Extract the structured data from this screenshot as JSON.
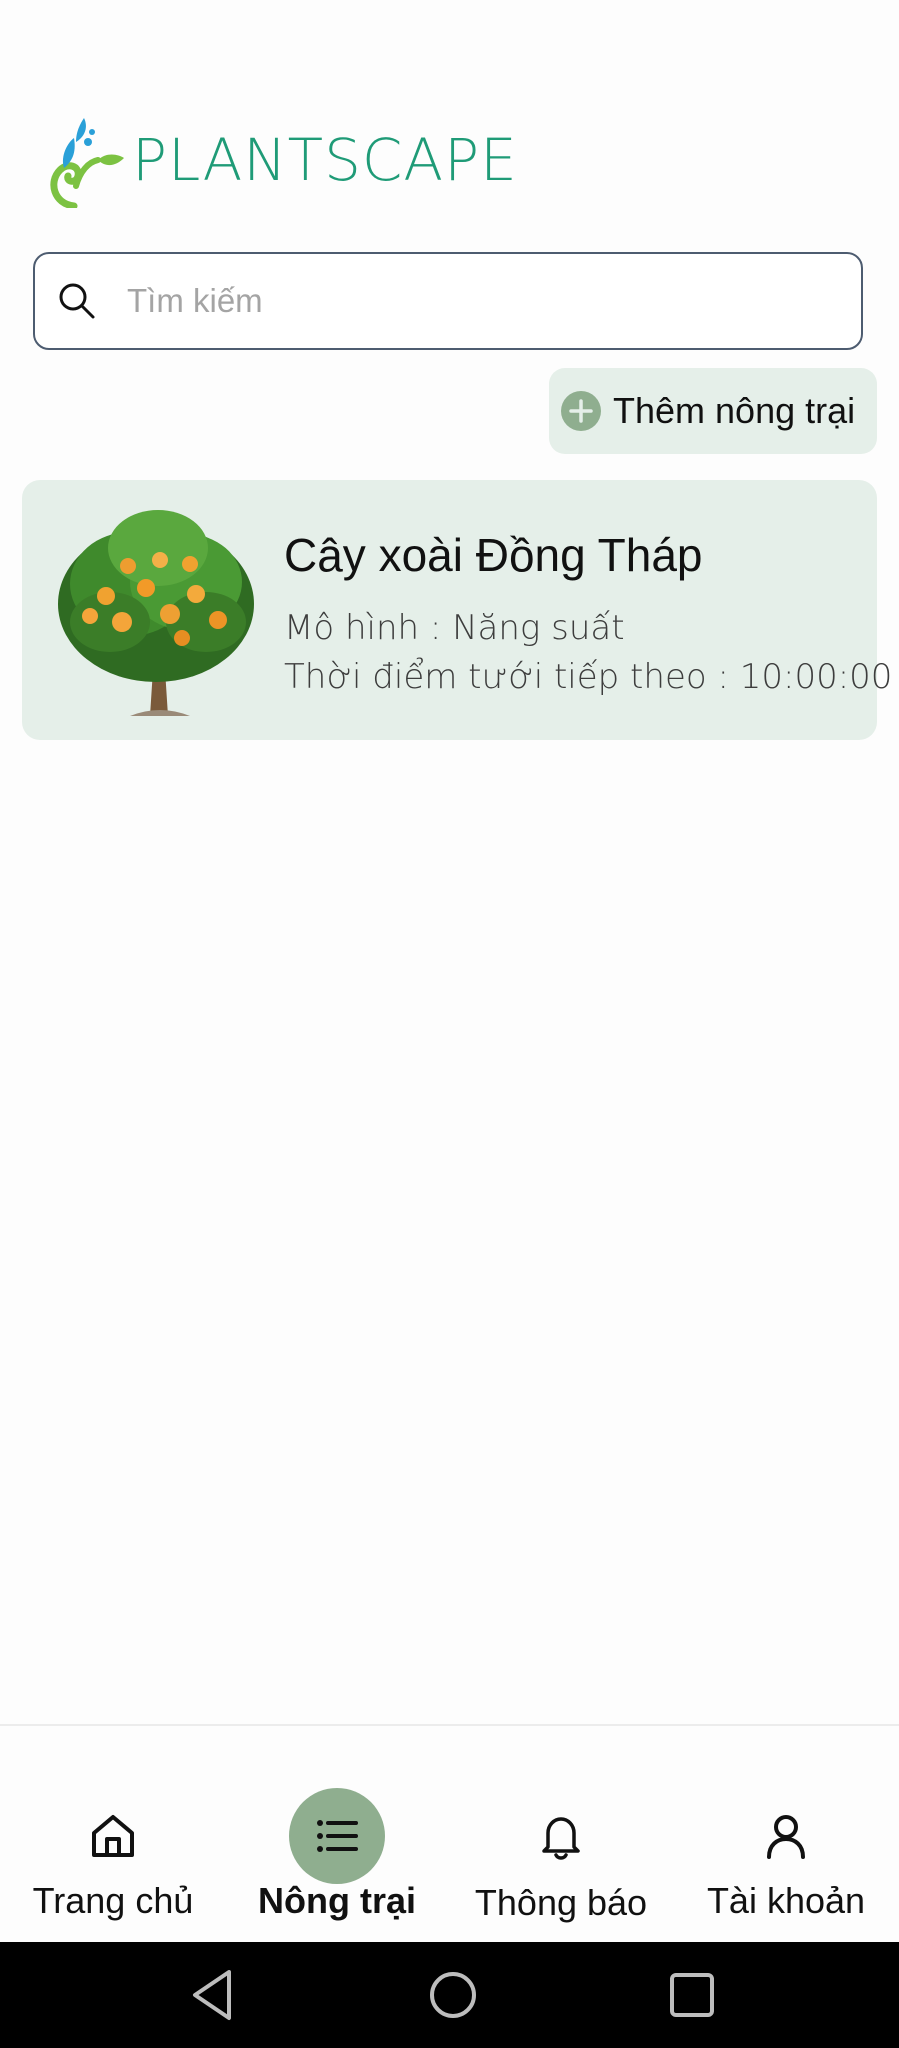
{
  "header": {
    "app_name": "PLANTSCAPE",
    "logo_icon": "plant-sprout-logo"
  },
  "search": {
    "placeholder": "Tìm kiếm",
    "value": "",
    "icon": "search-icon"
  },
  "add_farm": {
    "label": "Thêm nông trại",
    "icon": "plus-circle-icon"
  },
  "farms": [
    {
      "name": "Cây xoài Đồng Tháp",
      "model_line": "Mô hình : Năng suất",
      "next_water_line": "Thời điểm tưới tiếp theo : 10:00:00",
      "image": "mango-tree"
    }
  ],
  "bottom_nav": {
    "items": [
      {
        "label": "Trang chủ",
        "icon": "home-icon",
        "active": false
      },
      {
        "label": "Nông trại",
        "icon": "list-icon",
        "active": true
      },
      {
        "label": "Thông báo",
        "icon": "bell-icon",
        "active": false
      },
      {
        "label": "Tài khoản",
        "icon": "person-icon",
        "active": false
      }
    ]
  },
  "system_nav": [
    "back-icon",
    "home-circle-icon",
    "recents-icon"
  ],
  "colors": {
    "brand": "#1f9b77",
    "card_bg": "#e5efe9",
    "active_nav": "#8fae8f"
  }
}
